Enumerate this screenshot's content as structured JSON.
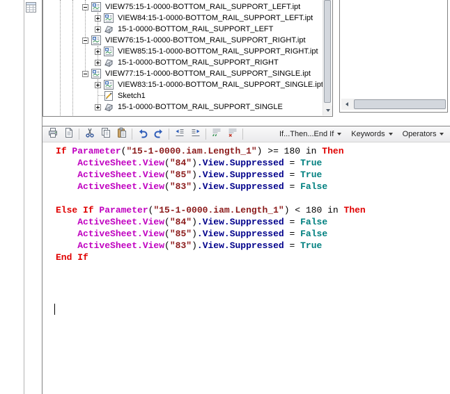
{
  "tree": {
    "items": [
      {
        "label": "VIEW75:15-1-0000-BOTTOM_RAIL_SUPPORT_LEFT.ipt",
        "level": 1,
        "expander": "minus",
        "icon": "drawing-view-icon"
      },
      {
        "label": "VIEW84:15-1-0000-BOTTOM_RAIL_SUPPORT_LEFT.ipt",
        "level": 2,
        "expander": "plus",
        "icon": "drawing-view-icon"
      },
      {
        "label": "15-1-0000-BOTTOM_RAIL_SUPPORT_LEFT",
        "level": 2,
        "expander": "plus",
        "icon": "part-icon"
      },
      {
        "label": "VIEW76:15-1-0000-BOTTOM_RAIL_SUPPORT_RIGHT.ipt",
        "level": 1,
        "expander": "minus",
        "icon": "drawing-view-icon"
      },
      {
        "label": "VIEW85:15-1-0000-BOTTOM_RAIL_SUPPORT_RIGHT.ipt",
        "level": 2,
        "expander": "plus",
        "icon": "drawing-view-icon"
      },
      {
        "label": "15-1-0000-BOTTOM_RAIL_SUPPORT_RIGHT",
        "level": 2,
        "expander": "plus",
        "icon": "part-icon"
      },
      {
        "label": "VIEW77:15-1-0000-BOTTOM_RAIL_SUPPORT_SINGLE.ipt",
        "level": 1,
        "expander": "minus",
        "icon": "drawing-view-icon"
      },
      {
        "label": "VIEW83:15-1-0000-BOTTOM_RAIL_SUPPORT_SINGLE.ipt",
        "level": 2,
        "expander": "plus",
        "icon": "drawing-view-icon"
      },
      {
        "label": "Sketch1",
        "level": 2,
        "expander": "none",
        "icon": "sketch-icon"
      },
      {
        "label": "15-1-0000-BOTTOM_RAIL_SUPPORT_SINGLE",
        "level": 2,
        "expander": "plus",
        "icon": "part-icon"
      }
    ]
  },
  "toolbar": {
    "snippets_dropdown_label": "If...Then...End If",
    "keywords_dropdown_label": "Keywords",
    "operators_dropdown_label": "Operators"
  },
  "code": {
    "colors": {
      "kw": "#e00000",
      "fn": "#c000c0",
      "prop": "#00008b",
      "str": "#8b1a1a",
      "bool": "#008080",
      "pl": "#000000"
    },
    "lines": [
      [
        {
          "t": "If ",
          "c": "kw"
        },
        {
          "t": "Parameter",
          "c": "fn"
        },
        {
          "t": "(",
          "c": "pl"
        },
        {
          "t": "\"15-1-0000.iam.Length_1\"",
          "c": "str"
        },
        {
          "t": ") >= 180 in ",
          "c": "pl"
        },
        {
          "t": "Then",
          "c": "kw"
        }
      ],
      [
        {
          "t": "    ",
          "c": "pl"
        },
        {
          "t": "ActiveSheet.View",
          "c": "fn"
        },
        {
          "t": "(",
          "c": "pl"
        },
        {
          "t": "\"84\"",
          "c": "str"
        },
        {
          "t": ")",
          "c": "pl"
        },
        {
          "t": ".View.Suppressed",
          "c": "prop"
        },
        {
          "t": " = ",
          "c": "pl"
        },
        {
          "t": "True",
          "c": "bool"
        }
      ],
      [
        {
          "t": "    ",
          "c": "pl"
        },
        {
          "t": "ActiveSheet.View",
          "c": "fn"
        },
        {
          "t": "(",
          "c": "pl"
        },
        {
          "t": "\"85\"",
          "c": "str"
        },
        {
          "t": ")",
          "c": "pl"
        },
        {
          "t": ".View.Suppressed",
          "c": "prop"
        },
        {
          "t": " = ",
          "c": "pl"
        },
        {
          "t": "True",
          "c": "bool"
        }
      ],
      [
        {
          "t": "    ",
          "c": "pl"
        },
        {
          "t": "ActiveSheet.View",
          "c": "fn"
        },
        {
          "t": "(",
          "c": "pl"
        },
        {
          "t": "\"83\"",
          "c": "str"
        },
        {
          "t": ")",
          "c": "pl"
        },
        {
          "t": ".View.Suppressed",
          "c": "prop"
        },
        {
          "t": " = ",
          "c": "pl"
        },
        {
          "t": "False",
          "c": "bool"
        }
      ],
      [],
      [
        {
          "t": "Else If ",
          "c": "kw"
        },
        {
          "t": "Parameter",
          "c": "fn"
        },
        {
          "t": "(",
          "c": "pl"
        },
        {
          "t": "\"15-1-0000.iam.Length_1\"",
          "c": "str"
        },
        {
          "t": ") < 180 in ",
          "c": "pl"
        },
        {
          "t": "Then",
          "c": "kw"
        }
      ],
      [
        {
          "t": "    ",
          "c": "pl"
        },
        {
          "t": "ActiveSheet.View",
          "c": "fn"
        },
        {
          "t": "(",
          "c": "pl"
        },
        {
          "t": "\"84\"",
          "c": "str"
        },
        {
          "t": ")",
          "c": "pl"
        },
        {
          "t": ".View.Suppressed",
          "c": "prop"
        },
        {
          "t": " = ",
          "c": "pl"
        },
        {
          "t": "False",
          "c": "bool"
        }
      ],
      [
        {
          "t": "    ",
          "c": "pl"
        },
        {
          "t": "ActiveSheet.View",
          "c": "fn"
        },
        {
          "t": "(",
          "c": "pl"
        },
        {
          "t": "\"85\"",
          "c": "str"
        },
        {
          "t": ")",
          "c": "pl"
        },
        {
          "t": ".View.Suppressed",
          "c": "prop"
        },
        {
          "t": " = ",
          "c": "pl"
        },
        {
          "t": "False",
          "c": "bool"
        }
      ],
      [
        {
          "t": "    ",
          "c": "pl"
        },
        {
          "t": "ActiveSheet.View",
          "c": "fn"
        },
        {
          "t": "(",
          "c": "pl"
        },
        {
          "t": "\"83\"",
          "c": "str"
        },
        {
          "t": ")",
          "c": "pl"
        },
        {
          "t": ".View.Suppressed",
          "c": "prop"
        },
        {
          "t": " = ",
          "c": "pl"
        },
        {
          "t": "True",
          "c": "bool"
        }
      ],
      [
        {
          "t": "End If",
          "c": "kw"
        }
      ]
    ]
  }
}
